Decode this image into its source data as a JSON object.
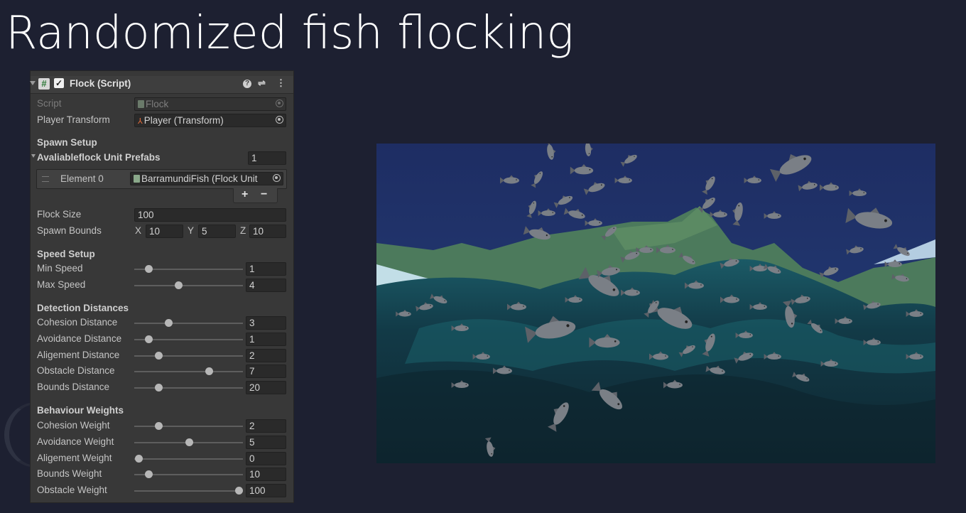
{
  "slide": {
    "title": "Randomized fish flocking"
  },
  "inspector": {
    "component_title": "Flock (Script)",
    "enabled": true,
    "header_icons": [
      "help-icon",
      "preset-icon",
      "kebab-menu-icon"
    ],
    "script_label": "Script",
    "script_value": "Flock",
    "player_transform_label": "Player Transform",
    "player_transform_value": "Player (Transform)",
    "spawn_setup": {
      "heading": "Spawn Setup",
      "prefabs_label": "Avaliableflock Unit Prefabs",
      "prefabs_count": "1",
      "element_label": "Element 0",
      "element_value": "BarramundiFish (Flock Unit",
      "add_label": "+",
      "remove_label": "−",
      "flock_size_label": "Flock Size",
      "flock_size_value": "100",
      "spawn_bounds_label": "Spawn Bounds",
      "bounds_x_label": "X",
      "bounds_x": "10",
      "bounds_y_label": "Y",
      "bounds_y": "5",
      "bounds_z_label": "Z",
      "bounds_z": "10"
    },
    "speed_setup": {
      "heading": "Speed Setup",
      "items": [
        {
          "label": "Min Speed",
          "value": "1",
          "level": 0.1
        },
        {
          "label": "Max Speed",
          "value": "4",
          "level": 0.4
        }
      ]
    },
    "detection": {
      "heading": "Detection Distances",
      "items": [
        {
          "label": "Cohesion Distance",
          "value": "3",
          "level": 0.3
        },
        {
          "label": "Avoidance Distance",
          "value": "1",
          "level": 0.1
        },
        {
          "label": "Aligement Distance",
          "value": "2",
          "level": 0.2
        },
        {
          "label": "Obstacle Distance",
          "value": "7",
          "level": 0.7
        },
        {
          "label": "Bounds Distance",
          "value": "20",
          "level": 0.2
        }
      ]
    },
    "weights": {
      "heading": "Behaviour Weights",
      "items": [
        {
          "label": "Cohesion Weight",
          "value": "2",
          "level": 0.2
        },
        {
          "label": "Avoidance Weight",
          "value": "5",
          "level": 0.5
        },
        {
          "label": "Aligement Weight",
          "value": "0",
          "level": 0.0
        },
        {
          "label": "Bounds Weight",
          "value": "10",
          "level": 0.1
        },
        {
          "label": "Obstacle Weight",
          "value": "100",
          "level": 1.0
        }
      ]
    }
  },
  "scene_colors": {
    "sky": "#1f2f66",
    "water_dark": "#0f2a33",
    "water_teal": "#1d6b73",
    "terrain": "#4f7c5c",
    "fish": "#7a7f86"
  }
}
